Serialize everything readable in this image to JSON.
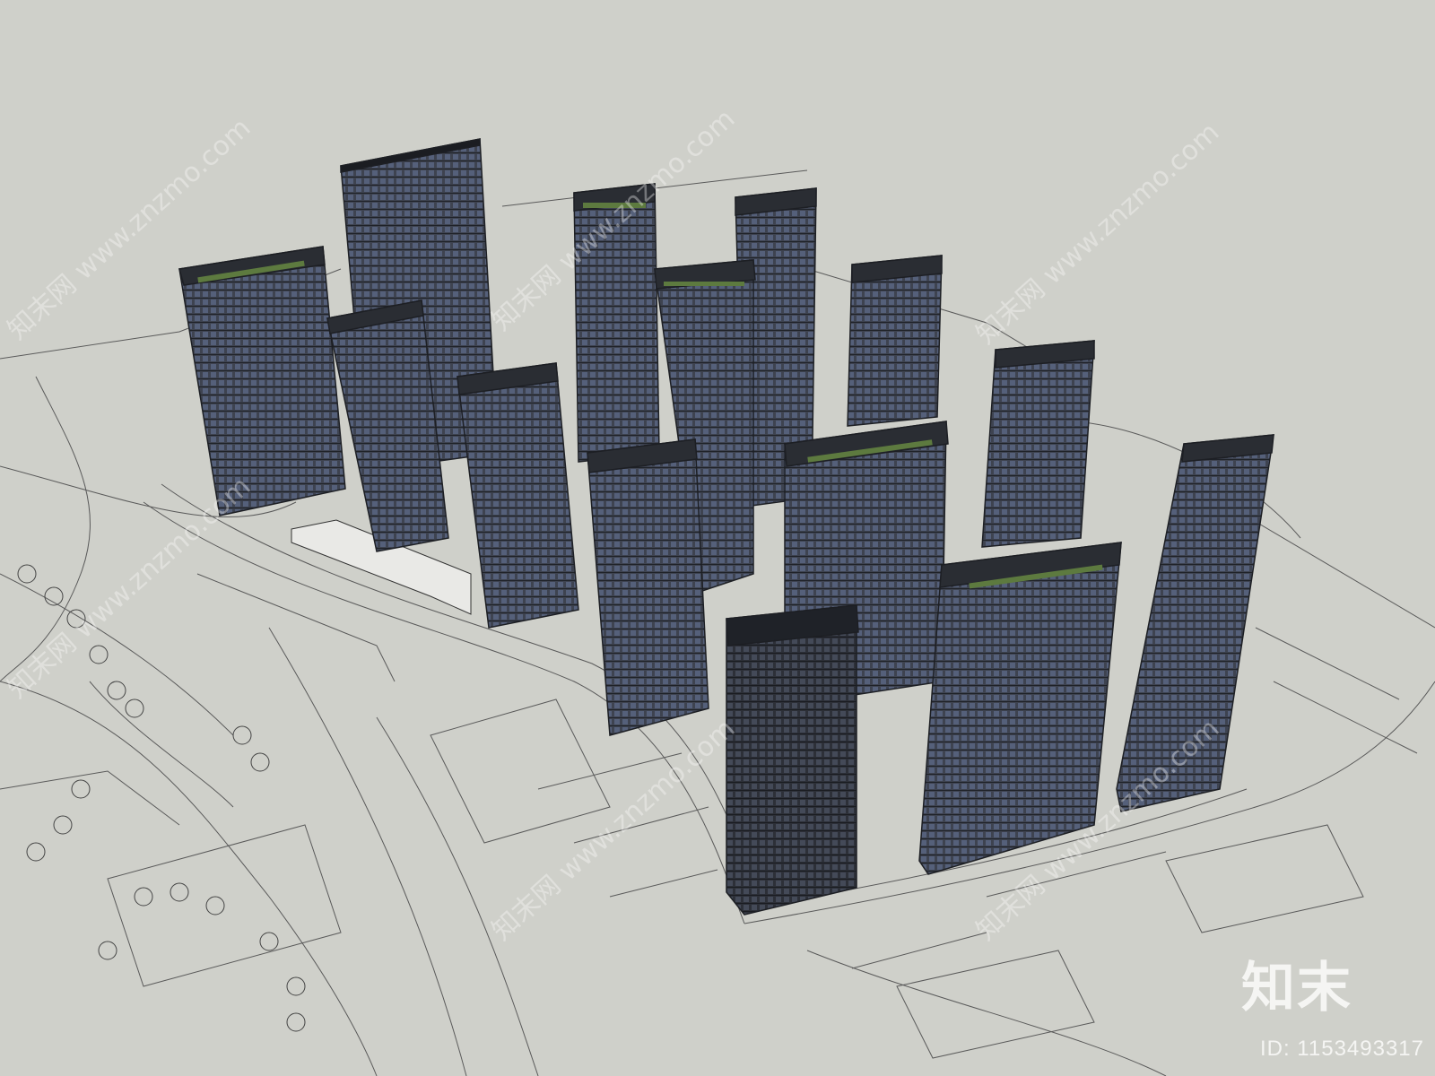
{
  "scene": {
    "description_type": "3d-architectural-model",
    "background_color": "#cfd0ca",
    "building_color": "#3c414d",
    "building_dark": "#23262d",
    "roof_garden_color": "#5d7a3f",
    "linework_color": "#555555"
  },
  "watermark": {
    "repeated_text": "知末网 www.znzmo.com",
    "logo": "知末",
    "id_label": "ID: 1153493317"
  }
}
